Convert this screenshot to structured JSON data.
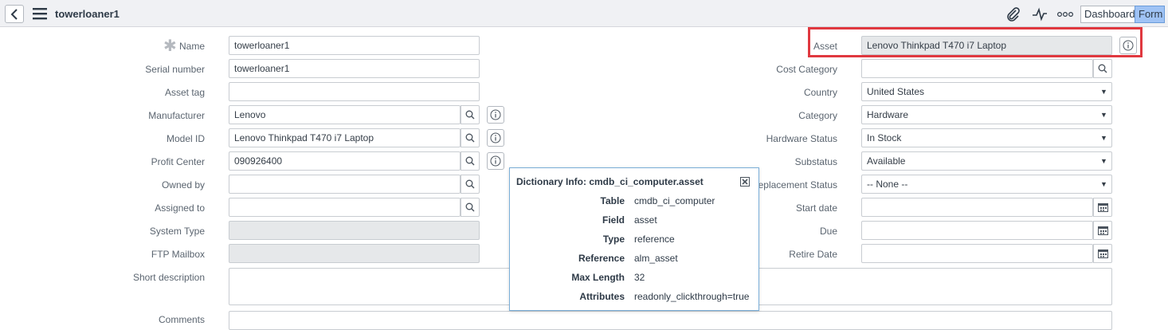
{
  "header": {
    "record_title": "towerloaner1",
    "buttons": {
      "dashboard": "Dashboard",
      "form": "Form"
    },
    "icons": [
      "back-icon",
      "menu-icon",
      "attachment-icon",
      "activity-icon",
      "more-options-icon"
    ]
  },
  "left_fields": [
    {
      "label": "Name",
      "value": "towerloaner1",
      "required": true
    },
    {
      "label": "Serial number",
      "value": "towerloaner1"
    },
    {
      "label": "Asset tag",
      "value": ""
    },
    {
      "label": "Manufacturer",
      "value": "Lenovo"
    },
    {
      "label": "Model ID",
      "value": "Lenovo Thinkpad T470 i7 Laptop"
    },
    {
      "label": "Profit Center",
      "value": "090926400"
    },
    {
      "label": "Owned by",
      "value": ""
    },
    {
      "label": "Assigned to",
      "value": ""
    },
    {
      "label": "System Type",
      "value": ""
    },
    {
      "label": "FTP Mailbox",
      "value": ""
    }
  ],
  "right_fields": [
    {
      "label": "Asset",
      "value": "Lenovo Thinkpad T470 i7 Laptop"
    },
    {
      "label": "Cost Category",
      "value": ""
    },
    {
      "label": "Country",
      "value": "United States"
    },
    {
      "label": "Category",
      "value": "Hardware"
    },
    {
      "label": "Hardware Status",
      "value": "In Stock"
    },
    {
      "label": "Substatus",
      "value": "Available"
    },
    {
      "label": "Replacement Status",
      "value": "-- None --"
    },
    {
      "label": "Start date",
      "value": ""
    },
    {
      "label": "Due",
      "value": ""
    },
    {
      "label": "Retire Date",
      "value": ""
    }
  ],
  "short_description": {
    "label": "Short description",
    "value": ""
  },
  "comments": {
    "label": "Comments"
  },
  "dictionary_popup": {
    "title": "Dictionary Info: cmdb_ci_computer.asset",
    "rows": [
      {
        "key": "Table",
        "value": "cmdb_ci_computer"
      },
      {
        "key": "Field",
        "value": "asset"
      },
      {
        "key": "Type",
        "value": "reference"
      },
      {
        "key": "Reference",
        "value": "alm_asset"
      },
      {
        "key": "Max Length",
        "value": "32"
      },
      {
        "key": "Attributes",
        "value": "readonly_clickthrough=true"
      }
    ]
  },
  "colors": {
    "header_bg": "#f0f1f4",
    "active_tab": "#9fc3f5",
    "highlight": "#e0383f",
    "readonly_bg": "#e6e8ea"
  }
}
